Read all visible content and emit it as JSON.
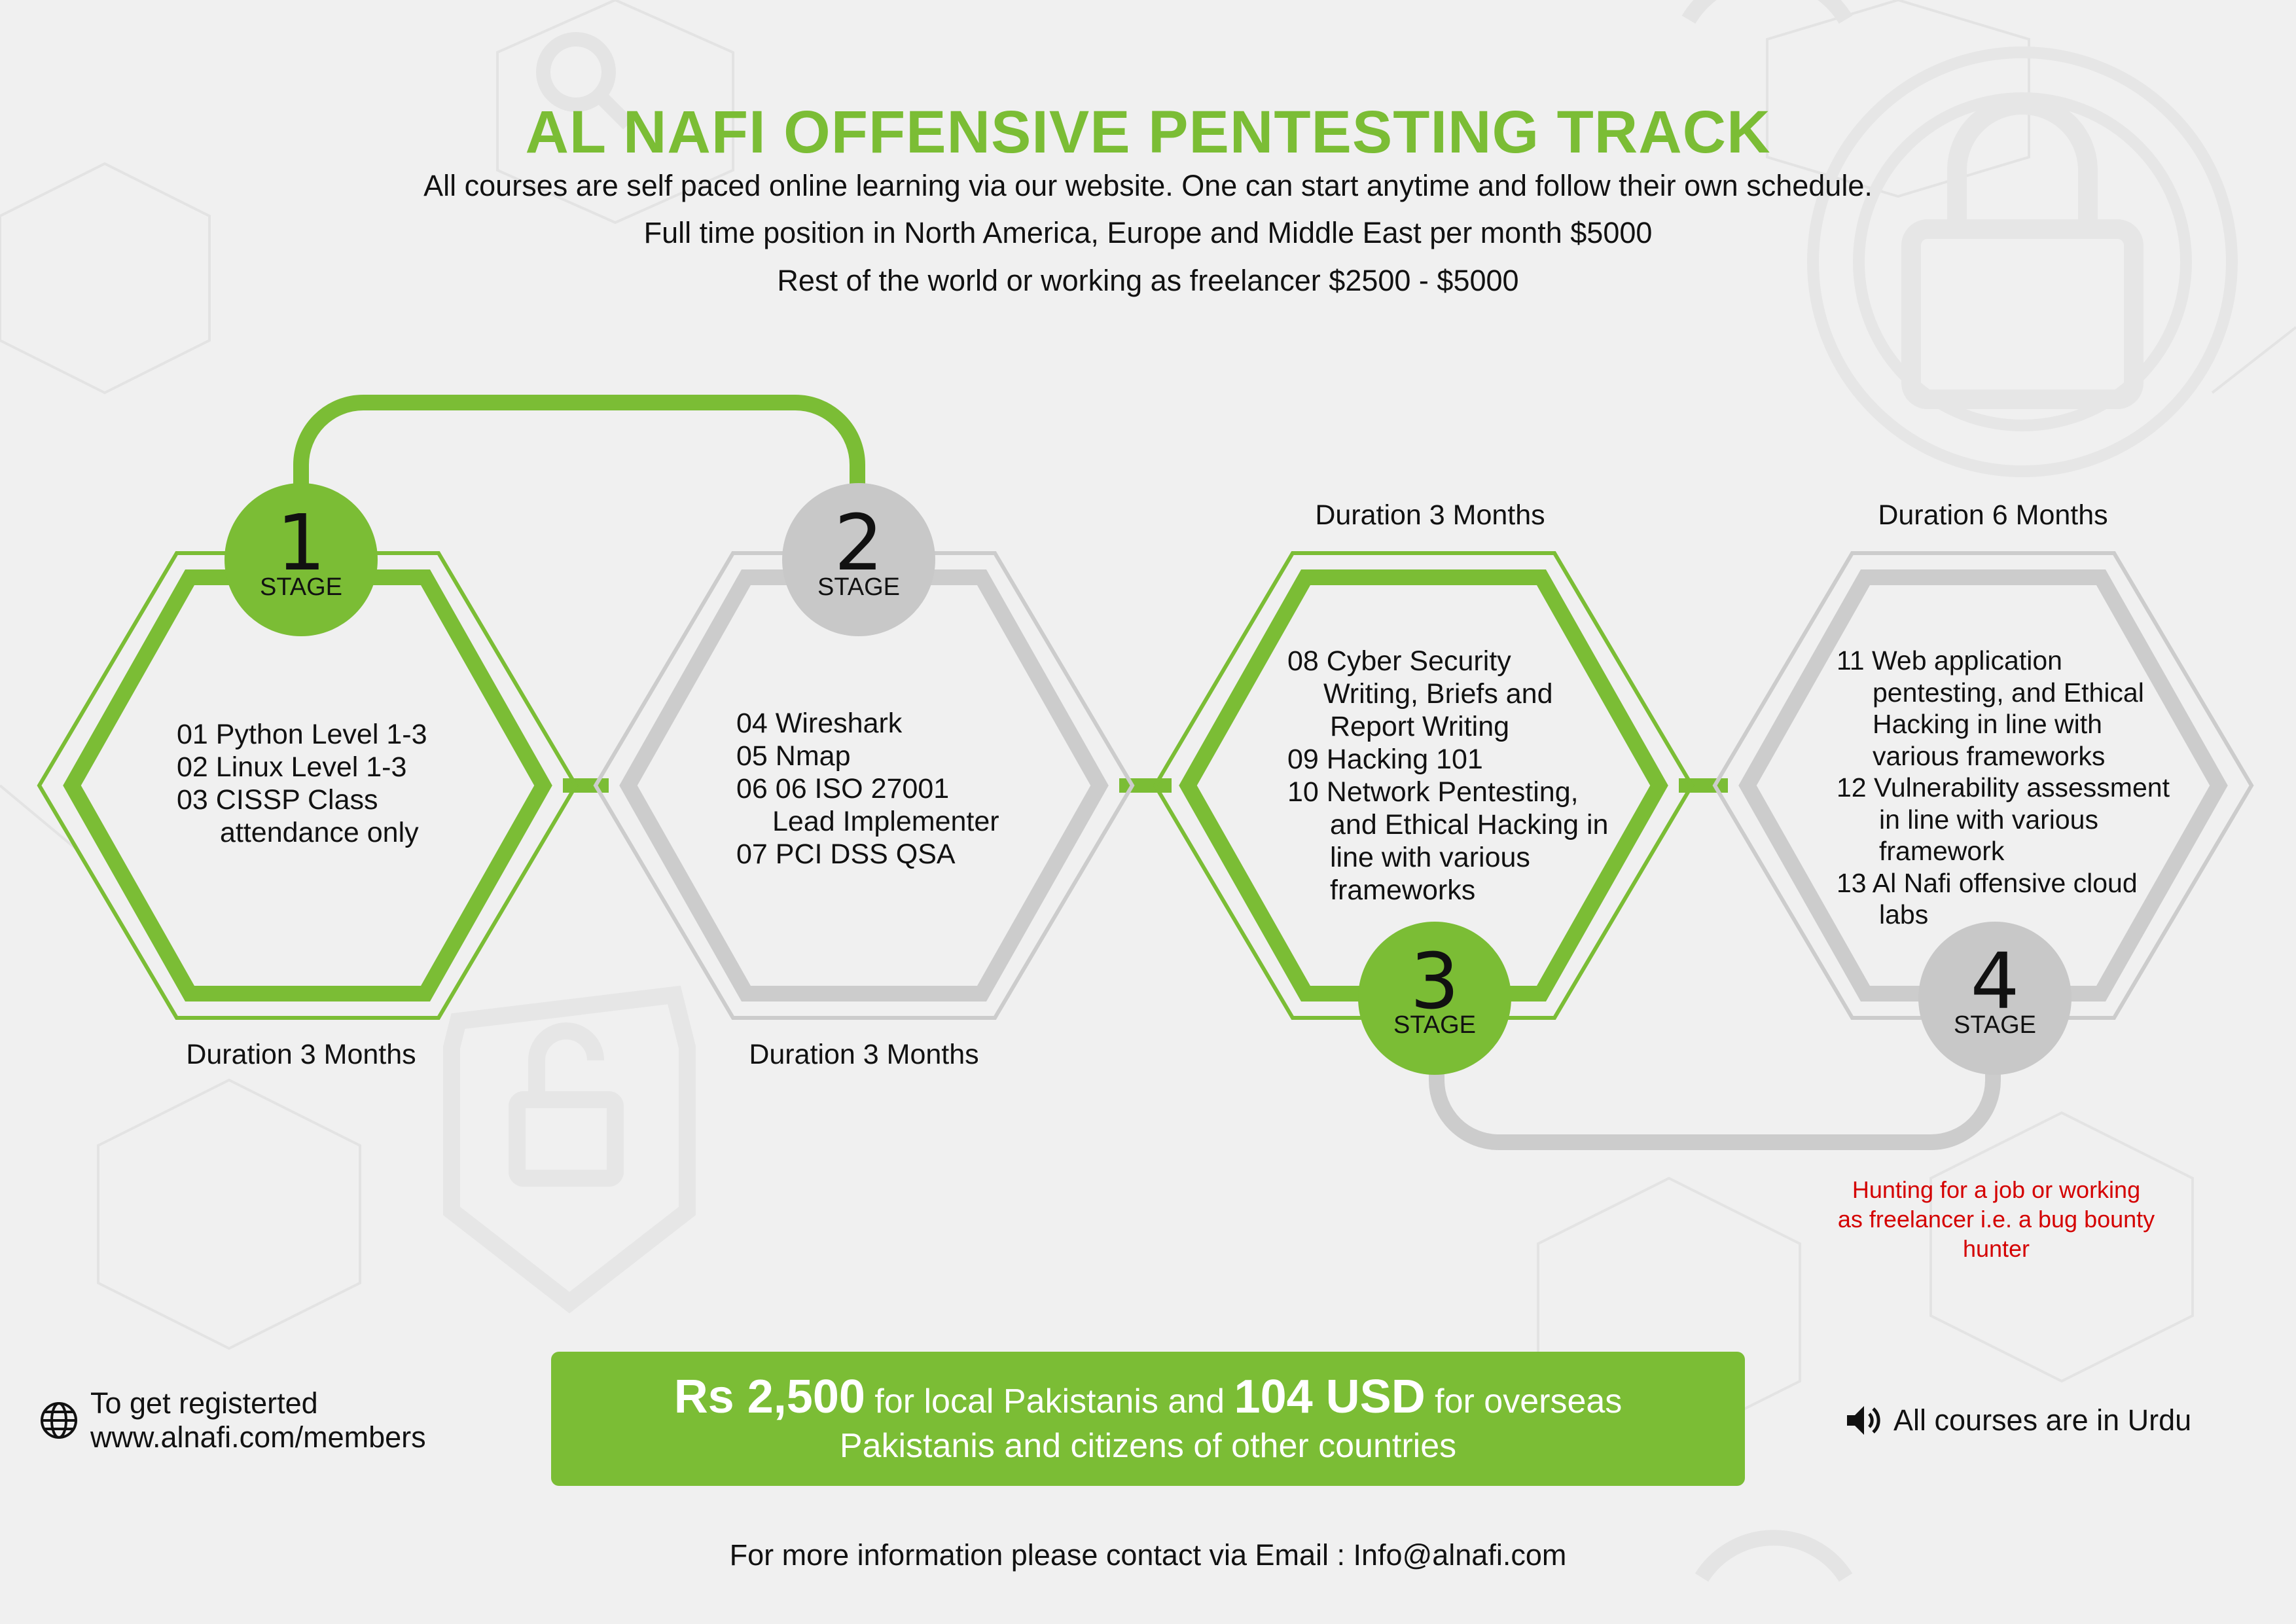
{
  "title": "AL NAFI OFFENSIVE PENTESTING TRACK",
  "subtitles": [
    "All courses are self paced online learning via our website. One can start anytime and follow their own schedule.",
    "Full time position in North America, Europe and Middle East per month $5000",
    "Rest of the world or working as freelancer $2500 - $5000"
  ],
  "colors": {
    "accent": "#7bbd35",
    "grey": "#c8c8c8",
    "warning": "#d40000",
    "background": "#f0f0f0"
  },
  "stages": [
    {
      "number": "1",
      "label": "STAGE",
      "color": "green",
      "duration": "Duration 3 Months",
      "courses": [
        "01 Python Level 1-3",
        "02 Linux Level 1-3",
        "03 CISSP Class",
        "attendance only"
      ]
    },
    {
      "number": "2",
      "label": "STAGE",
      "color": "grey",
      "duration": "Duration 3 Months",
      "courses": [
        "04 Wireshark",
        "05 Nmap",
        "06 06 ISO 27001",
        "Lead Implementer",
        "07 PCI DSS QSA"
      ]
    },
    {
      "number": "3",
      "label": "STAGE",
      "color": "green",
      "duration": "Duration 3 Months",
      "courses": [
        "08 Cyber Security",
        "Writing, Briefs and",
        "Report Writing",
        "09 Hacking 101",
        "10 Network Pentesting,",
        "and Ethical Hacking in",
        "line with various",
        "frameworks"
      ]
    },
    {
      "number": "4",
      "label": "STAGE",
      "color": "grey",
      "duration": "Duration 6 Months",
      "courses": [
        "11 Web application",
        "pentesting, and Ethical",
        "Hacking in line with",
        "various frameworks",
        "12 Vulnerability assessment",
        "in line with various",
        "framework",
        "13 Al Nafi offensive cloud",
        "labs"
      ]
    }
  ],
  "job_note": [
    "Hunting for a job or working",
    "as freelancer i.e. a bug bounty",
    "hunter"
  ],
  "registration": {
    "icon": "globe-icon",
    "line1": "To get registerted",
    "line2": "www.alnafi.com/members"
  },
  "price": {
    "amount_local": "Rs 2,500",
    "text_local": "for local Pakistanis and",
    "amount_overseas": "104 USD",
    "text_overseas": "for overseas",
    "line2": "Pakistanis and citizens of other countries"
  },
  "language": {
    "icon": "speaker-icon",
    "text": "All courses are in Urdu"
  },
  "footer": "For more information please contact via Email : Info@alnafi.com"
}
